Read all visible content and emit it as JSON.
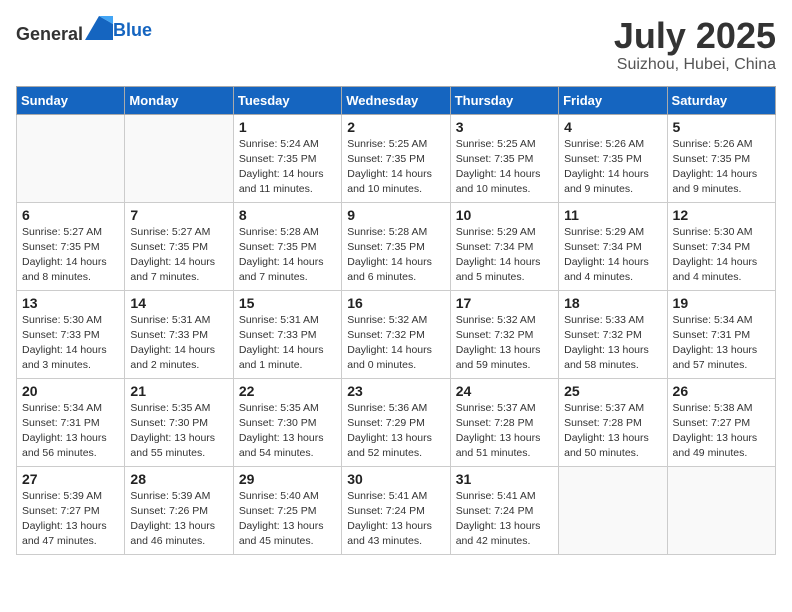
{
  "header": {
    "logo_general": "General",
    "logo_blue": "Blue",
    "month_year": "July 2025",
    "location": "Suizhou, Hubei, China"
  },
  "days_of_week": [
    "Sunday",
    "Monday",
    "Tuesday",
    "Wednesday",
    "Thursday",
    "Friday",
    "Saturday"
  ],
  "weeks": [
    [
      {
        "day": "",
        "info": ""
      },
      {
        "day": "",
        "info": ""
      },
      {
        "day": "1",
        "info": "Sunrise: 5:24 AM\nSunset: 7:35 PM\nDaylight: 14 hours and 11 minutes."
      },
      {
        "day": "2",
        "info": "Sunrise: 5:25 AM\nSunset: 7:35 PM\nDaylight: 14 hours and 10 minutes."
      },
      {
        "day": "3",
        "info": "Sunrise: 5:25 AM\nSunset: 7:35 PM\nDaylight: 14 hours and 10 minutes."
      },
      {
        "day": "4",
        "info": "Sunrise: 5:26 AM\nSunset: 7:35 PM\nDaylight: 14 hours and 9 minutes."
      },
      {
        "day": "5",
        "info": "Sunrise: 5:26 AM\nSunset: 7:35 PM\nDaylight: 14 hours and 9 minutes."
      }
    ],
    [
      {
        "day": "6",
        "info": "Sunrise: 5:27 AM\nSunset: 7:35 PM\nDaylight: 14 hours and 8 minutes."
      },
      {
        "day": "7",
        "info": "Sunrise: 5:27 AM\nSunset: 7:35 PM\nDaylight: 14 hours and 7 minutes."
      },
      {
        "day": "8",
        "info": "Sunrise: 5:28 AM\nSunset: 7:35 PM\nDaylight: 14 hours and 7 minutes."
      },
      {
        "day": "9",
        "info": "Sunrise: 5:28 AM\nSunset: 7:35 PM\nDaylight: 14 hours and 6 minutes."
      },
      {
        "day": "10",
        "info": "Sunrise: 5:29 AM\nSunset: 7:34 PM\nDaylight: 14 hours and 5 minutes."
      },
      {
        "day": "11",
        "info": "Sunrise: 5:29 AM\nSunset: 7:34 PM\nDaylight: 14 hours and 4 minutes."
      },
      {
        "day": "12",
        "info": "Sunrise: 5:30 AM\nSunset: 7:34 PM\nDaylight: 14 hours and 4 minutes."
      }
    ],
    [
      {
        "day": "13",
        "info": "Sunrise: 5:30 AM\nSunset: 7:33 PM\nDaylight: 14 hours and 3 minutes."
      },
      {
        "day": "14",
        "info": "Sunrise: 5:31 AM\nSunset: 7:33 PM\nDaylight: 14 hours and 2 minutes."
      },
      {
        "day": "15",
        "info": "Sunrise: 5:31 AM\nSunset: 7:33 PM\nDaylight: 14 hours and 1 minute."
      },
      {
        "day": "16",
        "info": "Sunrise: 5:32 AM\nSunset: 7:32 PM\nDaylight: 14 hours and 0 minutes."
      },
      {
        "day": "17",
        "info": "Sunrise: 5:32 AM\nSunset: 7:32 PM\nDaylight: 13 hours and 59 minutes."
      },
      {
        "day": "18",
        "info": "Sunrise: 5:33 AM\nSunset: 7:32 PM\nDaylight: 13 hours and 58 minutes."
      },
      {
        "day": "19",
        "info": "Sunrise: 5:34 AM\nSunset: 7:31 PM\nDaylight: 13 hours and 57 minutes."
      }
    ],
    [
      {
        "day": "20",
        "info": "Sunrise: 5:34 AM\nSunset: 7:31 PM\nDaylight: 13 hours and 56 minutes."
      },
      {
        "day": "21",
        "info": "Sunrise: 5:35 AM\nSunset: 7:30 PM\nDaylight: 13 hours and 55 minutes."
      },
      {
        "day": "22",
        "info": "Sunrise: 5:35 AM\nSunset: 7:30 PM\nDaylight: 13 hours and 54 minutes."
      },
      {
        "day": "23",
        "info": "Sunrise: 5:36 AM\nSunset: 7:29 PM\nDaylight: 13 hours and 52 minutes."
      },
      {
        "day": "24",
        "info": "Sunrise: 5:37 AM\nSunset: 7:28 PM\nDaylight: 13 hours and 51 minutes."
      },
      {
        "day": "25",
        "info": "Sunrise: 5:37 AM\nSunset: 7:28 PM\nDaylight: 13 hours and 50 minutes."
      },
      {
        "day": "26",
        "info": "Sunrise: 5:38 AM\nSunset: 7:27 PM\nDaylight: 13 hours and 49 minutes."
      }
    ],
    [
      {
        "day": "27",
        "info": "Sunrise: 5:39 AM\nSunset: 7:27 PM\nDaylight: 13 hours and 47 minutes."
      },
      {
        "day": "28",
        "info": "Sunrise: 5:39 AM\nSunset: 7:26 PM\nDaylight: 13 hours and 46 minutes."
      },
      {
        "day": "29",
        "info": "Sunrise: 5:40 AM\nSunset: 7:25 PM\nDaylight: 13 hours and 45 minutes."
      },
      {
        "day": "30",
        "info": "Sunrise: 5:41 AM\nSunset: 7:24 PM\nDaylight: 13 hours and 43 minutes."
      },
      {
        "day": "31",
        "info": "Sunrise: 5:41 AM\nSunset: 7:24 PM\nDaylight: 13 hours and 42 minutes."
      },
      {
        "day": "",
        "info": ""
      },
      {
        "day": "",
        "info": ""
      }
    ]
  ]
}
